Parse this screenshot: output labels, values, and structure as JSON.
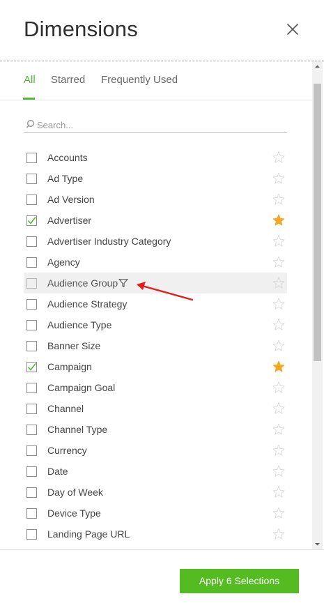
{
  "header": {
    "title": "Dimensions"
  },
  "tabs": [
    {
      "label": "All",
      "active": true
    },
    {
      "label": "Starred",
      "active": false
    },
    {
      "label": "Frequently Used",
      "active": false
    }
  ],
  "search": {
    "placeholder": "Search...",
    "value": ""
  },
  "items": [
    {
      "label": "Accounts",
      "checked": false,
      "starred": false
    },
    {
      "label": "Ad Type",
      "checked": false,
      "starred": false
    },
    {
      "label": "Ad Version",
      "checked": false,
      "starred": false
    },
    {
      "label": "Advertiser",
      "checked": true,
      "starred": true
    },
    {
      "label": "Advertiser Industry Category",
      "checked": false,
      "starred": false
    },
    {
      "label": "Agency",
      "checked": false,
      "starred": false
    },
    {
      "label": "Audience Group",
      "checked": false,
      "starred": false,
      "has_filter": true,
      "hover": true
    },
    {
      "label": "Audience Strategy",
      "checked": false,
      "starred": false
    },
    {
      "label": "Audience Type",
      "checked": false,
      "starred": false
    },
    {
      "label": "Banner Size",
      "checked": false,
      "starred": false
    },
    {
      "label": "Campaign",
      "checked": true,
      "starred": true
    },
    {
      "label": "Campaign Goal",
      "checked": false,
      "starred": false
    },
    {
      "label": "Channel",
      "checked": false,
      "starred": false
    },
    {
      "label": "Channel Type",
      "checked": false,
      "starred": false
    },
    {
      "label": "Currency",
      "checked": false,
      "starred": false
    },
    {
      "label": "Date",
      "checked": false,
      "starred": false
    },
    {
      "label": "Day of Week",
      "checked": false,
      "starred": false
    },
    {
      "label": "Device Type",
      "checked": false,
      "starred": false
    },
    {
      "label": "Landing Page URL",
      "checked": false,
      "starred": false
    }
  ],
  "footer": {
    "apply_label": "Apply 6 Selections"
  },
  "colors": {
    "accent": "#52b83a",
    "button": "#54bc20",
    "star_filled": "#f5a623",
    "star_empty": "#d9d9d9",
    "annotation_arrow": "#e0201b"
  },
  "icons": {
    "close": "close-icon",
    "search": "search-icon",
    "filter": "filter-icon",
    "star": "star-icon",
    "check": "check-icon"
  }
}
